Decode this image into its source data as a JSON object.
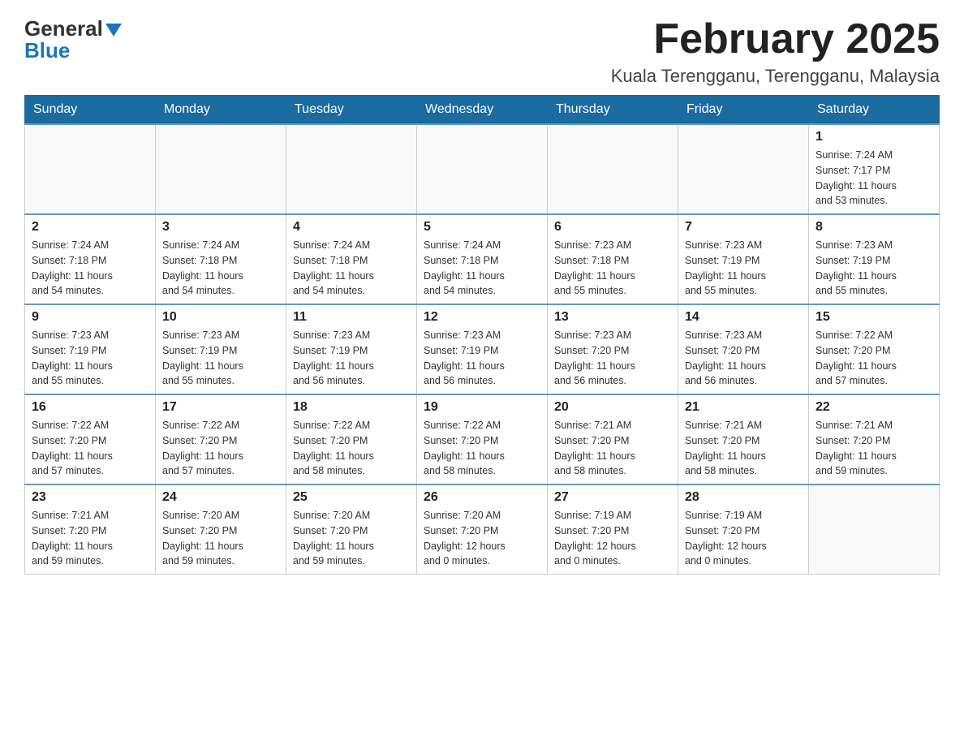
{
  "header": {
    "logo": {
      "general": "General",
      "blue": "Blue"
    },
    "title": "February 2025",
    "location": "Kuala Terengganu, Terengganu, Malaysia"
  },
  "weekdays": [
    "Sunday",
    "Monday",
    "Tuesday",
    "Wednesday",
    "Thursday",
    "Friday",
    "Saturday"
  ],
  "weeks": [
    [
      {
        "day": "",
        "info": ""
      },
      {
        "day": "",
        "info": ""
      },
      {
        "day": "",
        "info": ""
      },
      {
        "day": "",
        "info": ""
      },
      {
        "day": "",
        "info": ""
      },
      {
        "day": "",
        "info": ""
      },
      {
        "day": "1",
        "info": "Sunrise: 7:24 AM\nSunset: 7:17 PM\nDaylight: 11 hours\nand 53 minutes."
      }
    ],
    [
      {
        "day": "2",
        "info": "Sunrise: 7:24 AM\nSunset: 7:18 PM\nDaylight: 11 hours\nand 54 minutes."
      },
      {
        "day": "3",
        "info": "Sunrise: 7:24 AM\nSunset: 7:18 PM\nDaylight: 11 hours\nand 54 minutes."
      },
      {
        "day": "4",
        "info": "Sunrise: 7:24 AM\nSunset: 7:18 PM\nDaylight: 11 hours\nand 54 minutes."
      },
      {
        "day": "5",
        "info": "Sunrise: 7:24 AM\nSunset: 7:18 PM\nDaylight: 11 hours\nand 54 minutes."
      },
      {
        "day": "6",
        "info": "Sunrise: 7:23 AM\nSunset: 7:18 PM\nDaylight: 11 hours\nand 55 minutes."
      },
      {
        "day": "7",
        "info": "Sunrise: 7:23 AM\nSunset: 7:19 PM\nDaylight: 11 hours\nand 55 minutes."
      },
      {
        "day": "8",
        "info": "Sunrise: 7:23 AM\nSunset: 7:19 PM\nDaylight: 11 hours\nand 55 minutes."
      }
    ],
    [
      {
        "day": "9",
        "info": "Sunrise: 7:23 AM\nSunset: 7:19 PM\nDaylight: 11 hours\nand 55 minutes."
      },
      {
        "day": "10",
        "info": "Sunrise: 7:23 AM\nSunset: 7:19 PM\nDaylight: 11 hours\nand 55 minutes."
      },
      {
        "day": "11",
        "info": "Sunrise: 7:23 AM\nSunset: 7:19 PM\nDaylight: 11 hours\nand 56 minutes."
      },
      {
        "day": "12",
        "info": "Sunrise: 7:23 AM\nSunset: 7:19 PM\nDaylight: 11 hours\nand 56 minutes."
      },
      {
        "day": "13",
        "info": "Sunrise: 7:23 AM\nSunset: 7:20 PM\nDaylight: 11 hours\nand 56 minutes."
      },
      {
        "day": "14",
        "info": "Sunrise: 7:23 AM\nSunset: 7:20 PM\nDaylight: 11 hours\nand 56 minutes."
      },
      {
        "day": "15",
        "info": "Sunrise: 7:22 AM\nSunset: 7:20 PM\nDaylight: 11 hours\nand 57 minutes."
      }
    ],
    [
      {
        "day": "16",
        "info": "Sunrise: 7:22 AM\nSunset: 7:20 PM\nDaylight: 11 hours\nand 57 minutes."
      },
      {
        "day": "17",
        "info": "Sunrise: 7:22 AM\nSunset: 7:20 PM\nDaylight: 11 hours\nand 57 minutes."
      },
      {
        "day": "18",
        "info": "Sunrise: 7:22 AM\nSunset: 7:20 PM\nDaylight: 11 hours\nand 58 minutes."
      },
      {
        "day": "19",
        "info": "Sunrise: 7:22 AM\nSunset: 7:20 PM\nDaylight: 11 hours\nand 58 minutes."
      },
      {
        "day": "20",
        "info": "Sunrise: 7:21 AM\nSunset: 7:20 PM\nDaylight: 11 hours\nand 58 minutes."
      },
      {
        "day": "21",
        "info": "Sunrise: 7:21 AM\nSunset: 7:20 PM\nDaylight: 11 hours\nand 58 minutes."
      },
      {
        "day": "22",
        "info": "Sunrise: 7:21 AM\nSunset: 7:20 PM\nDaylight: 11 hours\nand 59 minutes."
      }
    ],
    [
      {
        "day": "23",
        "info": "Sunrise: 7:21 AM\nSunset: 7:20 PM\nDaylight: 11 hours\nand 59 minutes."
      },
      {
        "day": "24",
        "info": "Sunrise: 7:20 AM\nSunset: 7:20 PM\nDaylight: 11 hours\nand 59 minutes."
      },
      {
        "day": "25",
        "info": "Sunrise: 7:20 AM\nSunset: 7:20 PM\nDaylight: 11 hours\nand 59 minutes."
      },
      {
        "day": "26",
        "info": "Sunrise: 7:20 AM\nSunset: 7:20 PM\nDaylight: 12 hours\nand 0 minutes."
      },
      {
        "day": "27",
        "info": "Sunrise: 7:19 AM\nSunset: 7:20 PM\nDaylight: 12 hours\nand 0 minutes."
      },
      {
        "day": "28",
        "info": "Sunrise: 7:19 AM\nSunset: 7:20 PM\nDaylight: 12 hours\nand 0 minutes."
      },
      {
        "day": "",
        "info": ""
      }
    ]
  ]
}
